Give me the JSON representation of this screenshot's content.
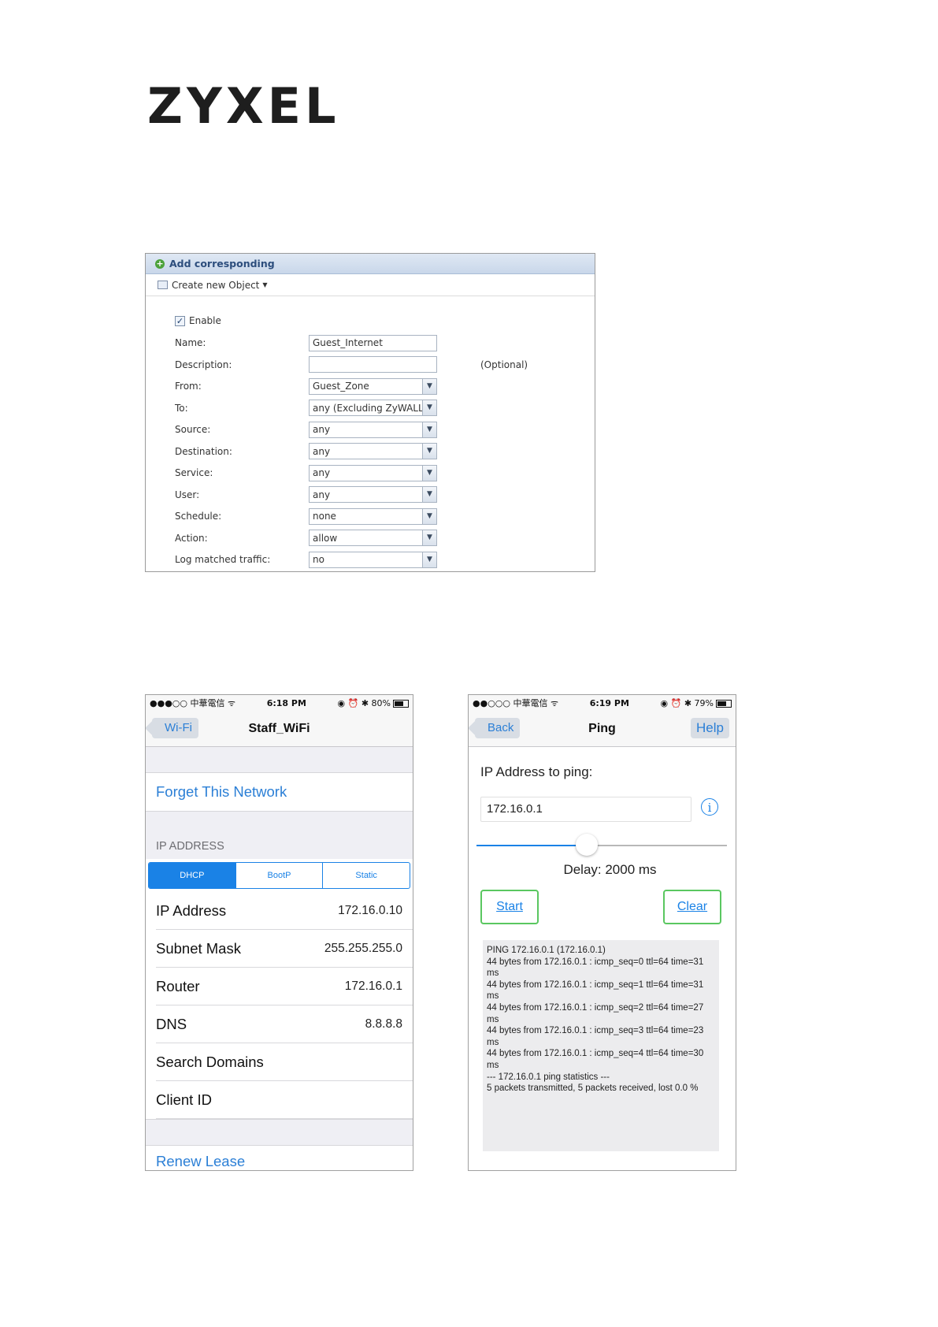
{
  "logo": {
    "text": "ZYXEL"
  },
  "policy": {
    "header": "Add corresponding",
    "toolbar": "Create new Object",
    "enable_label": "Enable",
    "fields": [
      {
        "label": "Name:",
        "value": "Guest_Internet",
        "dropdown": false
      },
      {
        "label": "Description:",
        "value": "",
        "dropdown": false
      },
      {
        "label": "From:",
        "value": "Guest_Zone",
        "dropdown": true
      },
      {
        "label": "To:",
        "value": "any (Excluding ZyWALL)",
        "dropdown": true
      },
      {
        "label": "Source:",
        "value": "any",
        "dropdown": true
      },
      {
        "label": "Destination:",
        "value": "any",
        "dropdown": true
      },
      {
        "label": "Service:",
        "value": "any",
        "dropdown": true
      },
      {
        "label": "User:",
        "value": "any",
        "dropdown": true
      },
      {
        "label": "Schedule:",
        "value": "none",
        "dropdown": true
      },
      {
        "label": "Action:",
        "value": "allow",
        "dropdown": true
      },
      {
        "label": "Log matched traffic:",
        "value": "no",
        "dropdown": true
      }
    ],
    "optional_note": "(Optional)"
  },
  "wifi": {
    "status": {
      "left": "●●●○○ 中華電信 ᯤ",
      "time": "6:18 PM",
      "right": "◉ ⏰ ✱ 80%",
      "battery_level": 0.8
    },
    "back_label": "Wi-Fi",
    "title": "Staff_WiFi",
    "forget": "Forget This Network",
    "ip_section": "IP ADDRESS",
    "segments": [
      "DHCP",
      "BootP",
      "Static"
    ],
    "rows": [
      {
        "label": "IP Address",
        "value": "172.16.0.10"
      },
      {
        "label": "Subnet Mask",
        "value": "255.255.255.0"
      },
      {
        "label": "Router",
        "value": "172.16.0.1"
      },
      {
        "label": "DNS",
        "value": "8.8.8.8"
      },
      {
        "label": "Search Domains",
        "value": ""
      },
      {
        "label": "Client ID",
        "value": ""
      }
    ],
    "renew": "Renew Lease"
  },
  "ping": {
    "status": {
      "left": "●●○○○ 中華電信 ᯤ",
      "time": "6:19 PM",
      "right": "◉ ⏰ ✱ 79%",
      "battery_level": 0.79
    },
    "back_label": "Back",
    "title": "Ping",
    "help_label": "Help",
    "ip_label": "IP Address to ping:",
    "ip_value": "172.16.0.1",
    "slider_value": 0.44,
    "delay": "Delay: 2000 ms",
    "start_label": "Start",
    "clear_label": "Clear",
    "output": [
      "PING 172.16.0.1 (172.16.0.1)",
      "44 bytes from 172.16.0.1 : icmp_seq=0 ttl=64 time=31 ms",
      "44 bytes from 172.16.0.1 : icmp_seq=1 ttl=64 time=31 ms",
      "44 bytes from 172.16.0.1 : icmp_seq=2 ttl=64 time=27 ms",
      "44 bytes from 172.16.0.1 : icmp_seq=3 ttl=64 time=23 ms",
      "44 bytes from 172.16.0.1 : icmp_seq=4 ttl=64 time=30 ms",
      "--- 172.16.0.1 ping statistics ---",
      "5 packets transmitted, 5 packets received, lost 0.0 %"
    ]
  }
}
